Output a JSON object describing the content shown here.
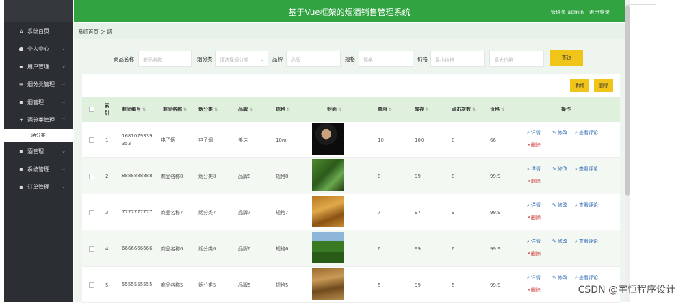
{
  "header": {
    "title": "基于Vue框架的烟酒销售管理系统",
    "user": "管理员 admin",
    "logout": "退出登录"
  },
  "breadcrumb": "系统首页 ＞ 烟",
  "sidebar": {
    "items": [
      {
        "label": "系统首页",
        "icon": "home-icon",
        "chevron": ""
      },
      {
        "label": "个人中心",
        "icon": "user-icon",
        "chevron": "⌄"
      },
      {
        "label": "用户管理",
        "icon": "grid-icon",
        "chevron": "⌄"
      },
      {
        "label": "烟分类管理",
        "icon": "sliders-icon",
        "chevron": "⌄"
      },
      {
        "label": "烟管理",
        "icon": "grid-icon",
        "chevron": "⌄"
      },
      {
        "label": "酒分类管理",
        "icon": "wine-icon",
        "chevron": "⌃"
      }
    ],
    "sub": "酒分类",
    "items2": [
      {
        "label": "酒管理",
        "icon": "grid-icon",
        "chevron": "⌄"
      },
      {
        "label": "系统管理",
        "icon": "grid-icon",
        "chevron": "⌄"
      },
      {
        "label": "订单管理",
        "icon": "grid-icon",
        "chevron": "⌄"
      }
    ]
  },
  "search": {
    "name_label": "商品名称",
    "name_placeholder": "商品名称",
    "cat_label": "烟分类",
    "cat_placeholder": "请选择烟分类",
    "brand_label": "品牌",
    "brand_placeholder": "品牌",
    "spec_label": "规格",
    "spec_placeholder": "规格",
    "price_label": "价格",
    "price_min_placeholder": "最小价格",
    "price_max_placeholder": "最大价格",
    "button": "查询"
  },
  "toolbar": {
    "add": "新增",
    "delete": "删除"
  },
  "table": {
    "headers": {
      "index": "索\n引",
      "code": "商品编号",
      "name": "商品名称",
      "cat": "烟分类",
      "brand": "品牌",
      "spec": "规格",
      "cover": "封面",
      "limit": "单限",
      "stock": "库存",
      "clicks": "点击次数",
      "price": "价格",
      "ops": "操作"
    },
    "actions": {
      "detail": "详情",
      "edit": "修改",
      "comments": "查看评论",
      "del": "删除"
    },
    "rows": [
      {
        "index": "1",
        "code": "1681079339353",
        "name": "电子烟",
        "cat": "电子烟",
        "brand": "美达",
        "spec": "10ml",
        "limit": "10",
        "stock": "100",
        "clicks": "0",
        "price": "66"
      },
      {
        "index": "2",
        "code": "8888888888",
        "name": "商品名称8",
        "cat": "烟分类8",
        "brand": "品牌8",
        "spec": "规格8",
        "limit": "8",
        "stock": "99",
        "clicks": "8",
        "price": "99.9"
      },
      {
        "index": "3",
        "code": "7777777777",
        "name": "商品名称7",
        "cat": "烟分类7",
        "brand": "品牌7",
        "spec": "规格7",
        "limit": "7",
        "stock": "97",
        "clicks": "9",
        "price": "99.9"
      },
      {
        "index": "4",
        "code": "6666666666",
        "name": "商品名称6",
        "cat": "烟分类6",
        "brand": "品牌6",
        "spec": "规格6",
        "limit": "6",
        "stock": "99",
        "clicks": "6",
        "price": "99.9"
      },
      {
        "index": "5",
        "code": "5555555555",
        "name": "商品名称5",
        "cat": "烟分类5",
        "brand": "品牌5",
        "spec": "规格5",
        "limit": "5",
        "stock": "99",
        "clicks": "5",
        "price": "99.9"
      }
    ]
  },
  "watermark": "CSDN @宇恒程序设计"
}
